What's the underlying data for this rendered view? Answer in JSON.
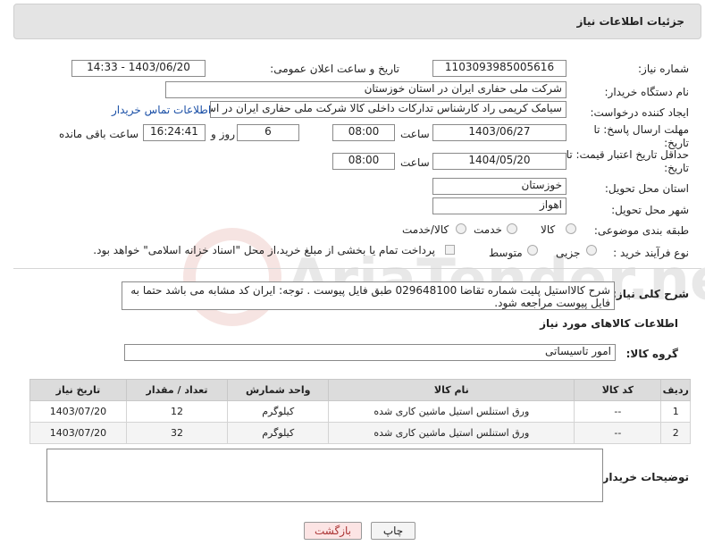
{
  "header": {
    "title": "جزئیات اطلاعات نیاز"
  },
  "form": {
    "need_number": {
      "label": "شماره نیاز:",
      "value": "1103093985005616"
    },
    "announce": {
      "label": "تاریخ و ساعت اعلان عمومی:",
      "value": "1403/06/20 - 14:33"
    },
    "buyer": {
      "label": "نام دستگاه خریدار:",
      "value": "شرکت ملی حفاری ایران در استان خوزستان"
    },
    "requester": {
      "label": "ایجاد کننده درخواست:",
      "value": "سیامک کریمی راد کارشناس تدارکات داخلی کالا شرکت ملی حفاری ایران در اس",
      "contact_link": "اطلاعات تماس خریدار"
    },
    "deadline": {
      "label_line1": "مهلت ارسال پاسخ: تا",
      "label_line2": "تاریخ:",
      "date": "1403/06/27",
      "time_label": "ساعت",
      "time": "08:00",
      "days": "6",
      "days_label": "روز و",
      "remaining": "16:24:41",
      "remaining_label": "ساعت باقی مانده"
    },
    "validity": {
      "label_line1": "حداقل تاریخ اعتبار قیمت: تا",
      "label_line2": "تاریخ:",
      "date": "1404/05/20",
      "time_label": "ساعت",
      "time": "08:00"
    },
    "province": {
      "label": "استان محل تحویل:",
      "value": "خوزستان"
    },
    "city": {
      "label": "شهر محل تحویل:",
      "value": "اهواز"
    },
    "category": {
      "label": "طبقه بندی موضوعی:",
      "options": [
        "کالا",
        "خدمت",
        "کالا/خدمت"
      ]
    },
    "process": {
      "label": "نوع فرآیند خرید :",
      "options": [
        "جزیی",
        "متوسط"
      ],
      "payment_note": "پرداخت تمام یا بخشی از مبلغ خرید،از محل \"اسناد خزانه اسلامی\" خواهد بود."
    }
  },
  "description": {
    "label": "شرح کلی نیاز:",
    "text": "شرح کالااستیل پلیت شماره تقاضا 029648100 طبق فایل پیوست . توجه: ایران کد مشابه می باشد حتما به فایل پیوست مراجعه شود."
  },
  "goods": {
    "section_title": "اطلاعات کالاهای مورد نیاز",
    "group_label": "گروه کالا:",
    "group_value": "امور تاسیساتی",
    "columns": [
      "ردیف",
      "کد کالا",
      "نام کالا",
      "واحد شمارش",
      "تعداد / مقدار",
      "تاریخ نیاز"
    ],
    "rows": [
      [
        "1",
        "--",
        "ورق استنلس استیل ماشین کاری شده",
        "کیلوگرم",
        "12",
        "1403/07/20"
      ],
      [
        "2",
        "--",
        "ورق استنلس استیل ماشین کاری شده",
        "کیلوگرم",
        "32",
        "1403/07/20"
      ]
    ]
  },
  "buyer_notes": {
    "label": "توضیحات خریدار:"
  },
  "buttons": {
    "print": "چاپ",
    "back": "بازگشت"
  },
  "watermark": "AriaTender.neT"
}
